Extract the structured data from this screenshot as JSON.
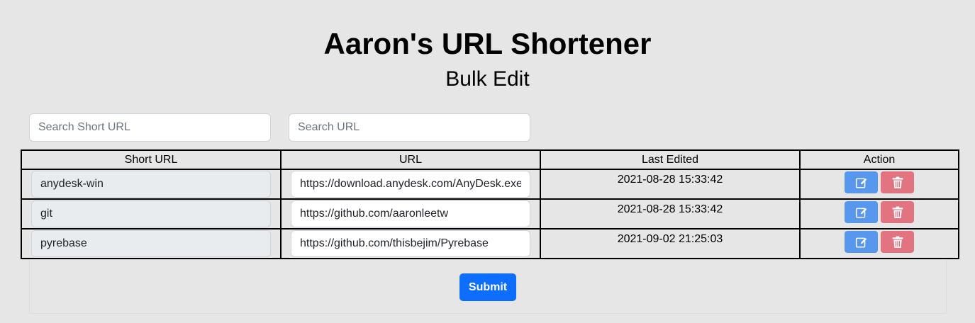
{
  "header": {
    "title": "Aaron's URL Shortener",
    "subtitle": "Bulk Edit"
  },
  "search": {
    "short_placeholder": "Search Short URL",
    "url_placeholder": "Search URL"
  },
  "table": {
    "columns": [
      "Short URL",
      "URL",
      "Last Edited",
      "Action"
    ],
    "rows": [
      {
        "short_url": "anydesk-win",
        "url": "https://download.anydesk.com/AnyDesk.exe",
        "last_edited": "2021-08-28 15:33:42"
      },
      {
        "short_url": "git",
        "url": "https://github.com/aaronleetw",
        "last_edited": "2021-08-28 15:33:42"
      },
      {
        "short_url": "pyrebase",
        "url": "https://github.com/thisbejim/Pyrebase",
        "last_edited": "2021-09-02 21:25:03"
      }
    ]
  },
  "icons": {
    "edit": "edit-icon",
    "delete": "trash-icon"
  },
  "colors": {
    "primary": "#0d6efd",
    "edit_button": "#5797ee",
    "delete_button": "#e17480",
    "background": "#e6e6e6"
  },
  "submit_label": "Submit"
}
